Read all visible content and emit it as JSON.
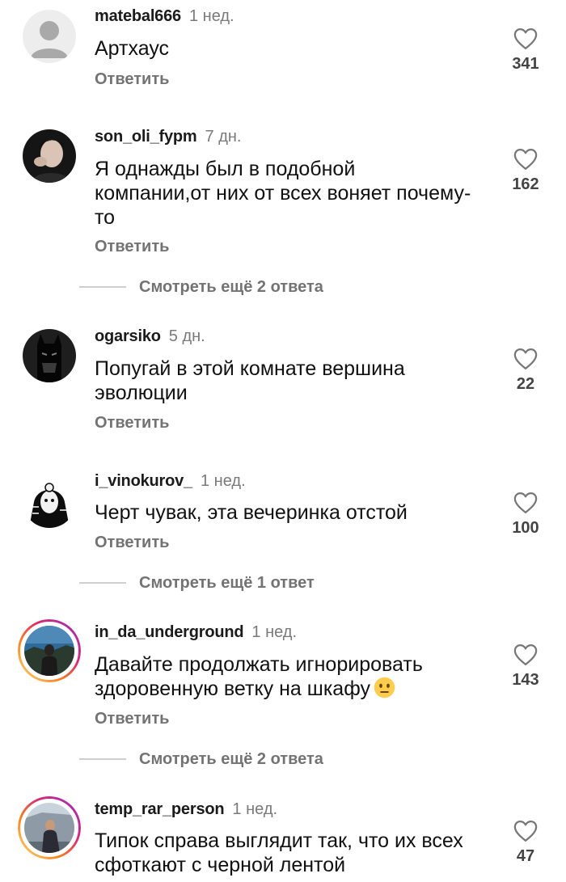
{
  "comments": [
    {
      "username": "matebal666",
      "time": "1 нед.",
      "text": "Артхаус",
      "reply_label": "Ответить",
      "likes": "341",
      "avatar_icon": "default-user-icon"
    },
    {
      "username": "son_oli_fypm",
      "time": "7 дн.",
      "text": "Я однажды был в подобной компании,от них от всех воняет почему-то",
      "reply_label": "Ответить",
      "likes": "162",
      "more_replies": "Смотреть ещё 2 ответа",
      "avatar_icon": "person-photo"
    },
    {
      "username": "ogarsiko",
      "time": "5 дн.",
      "text": "Попугай в этой комнате вершина эволюции",
      "reply_label": "Ответить",
      "likes": "22",
      "avatar_icon": "batman-photo"
    },
    {
      "username": "i_vinokurov_",
      "time": "1 нед.",
      "text": "Черт чувак, эта вечеринка отстой",
      "reply_label": "Ответить",
      "likes": "100",
      "more_replies": "Смотреть ещё 1 ответ",
      "avatar_icon": "masked-figure-photo"
    },
    {
      "username": "in_da_underground",
      "time": "1 нед.",
      "text": "Давайте продолжать игнорировать здоровенную ветку на шкафу",
      "emoji": "neutral-face-emoji",
      "reply_label": "Ответить",
      "likes": "143",
      "more_replies": "Смотреть ещё 2 ответа",
      "avatar_icon": "landscape-person-photo"
    },
    {
      "username": "temp_rar_person",
      "time": "1 нед.",
      "text": "Типок справа выглядит так, что их всех сфоткают с черной лентой",
      "likes": "47",
      "avatar_icon": "person-car-photo"
    }
  ],
  "colors": {
    "text": "#111111",
    "secondary": "#737373",
    "story_ring": "#d62976"
  }
}
